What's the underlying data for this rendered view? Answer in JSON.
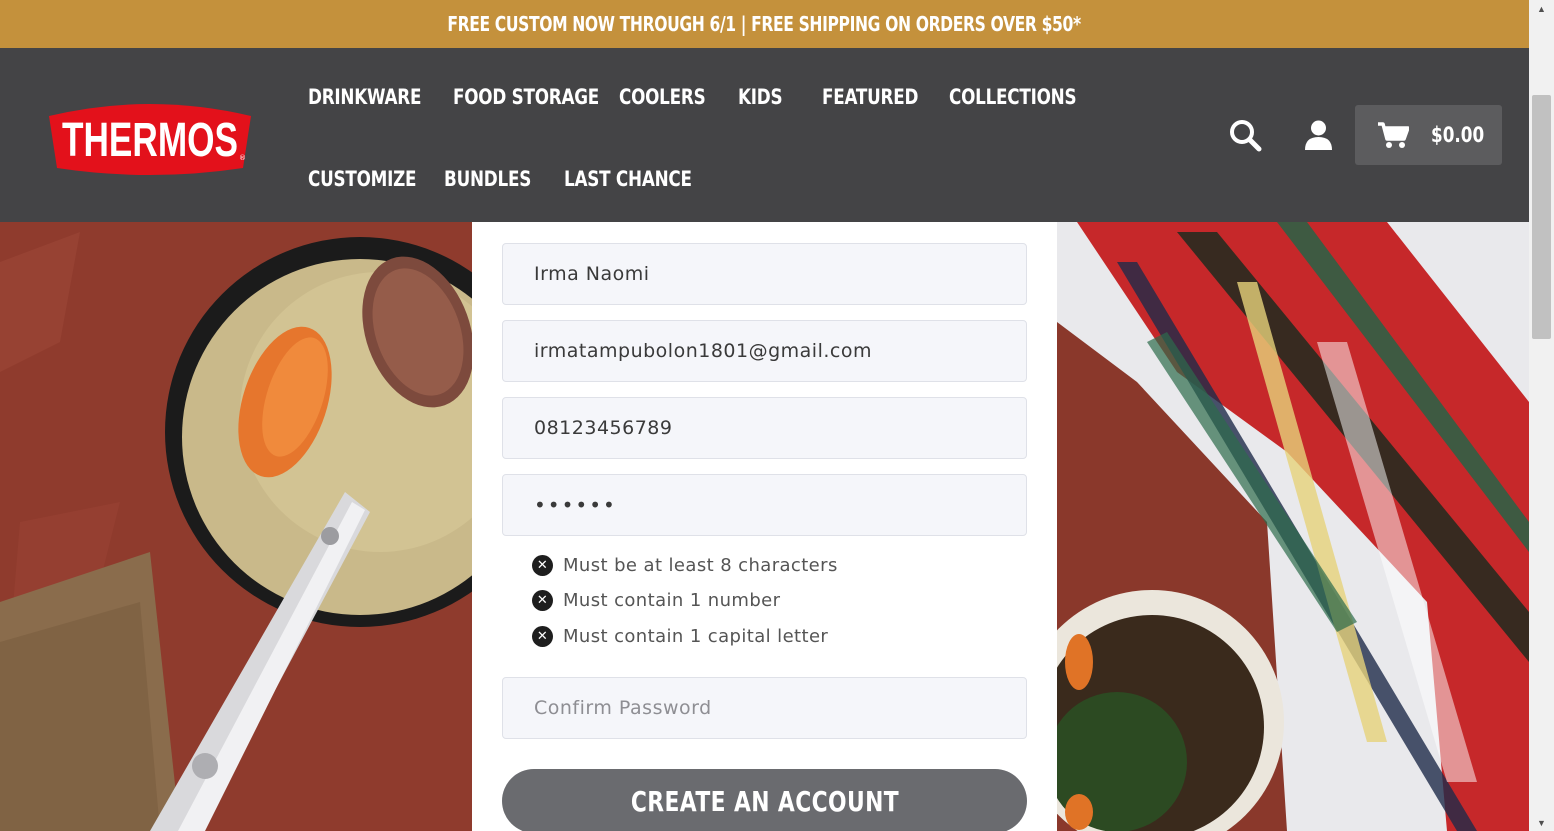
{
  "promo": {
    "text": "FREE CUSTOM NOW THROUGH 6/1 | FREE SHIPPING ON ORDERS OVER $50*"
  },
  "brand": {
    "logo_text": "THERMOS",
    "logo_color": "#e3111b",
    "banner_color": "#c4913c",
    "header_color": "#444446"
  },
  "nav": {
    "row1": [
      "DRINKWARE",
      "FOOD STORAGE",
      "COOLERS",
      "KIDS",
      "FEATURED",
      "COLLECTIONS"
    ],
    "row2": [
      "CUSTOMIZE",
      "BUNDLES",
      "LAST CHANCE"
    ]
  },
  "header_icons": {
    "search": "search-icon",
    "account": "user-icon",
    "cart": "cart-icon"
  },
  "cart": {
    "amount": "$0.00"
  },
  "form": {
    "name_value": "Irma Naomi",
    "email_value": "irmatampubolon1801@gmail.com",
    "phone_value": "08123456789",
    "password_masked": "••••••",
    "password_rules": [
      "Must be at least 8 characters",
      "Must contain 1 number",
      "Must contain 1 capital letter"
    ],
    "confirm_placeholder": "Confirm Password",
    "submit_label": "CREATE AN ACCOUNT"
  }
}
